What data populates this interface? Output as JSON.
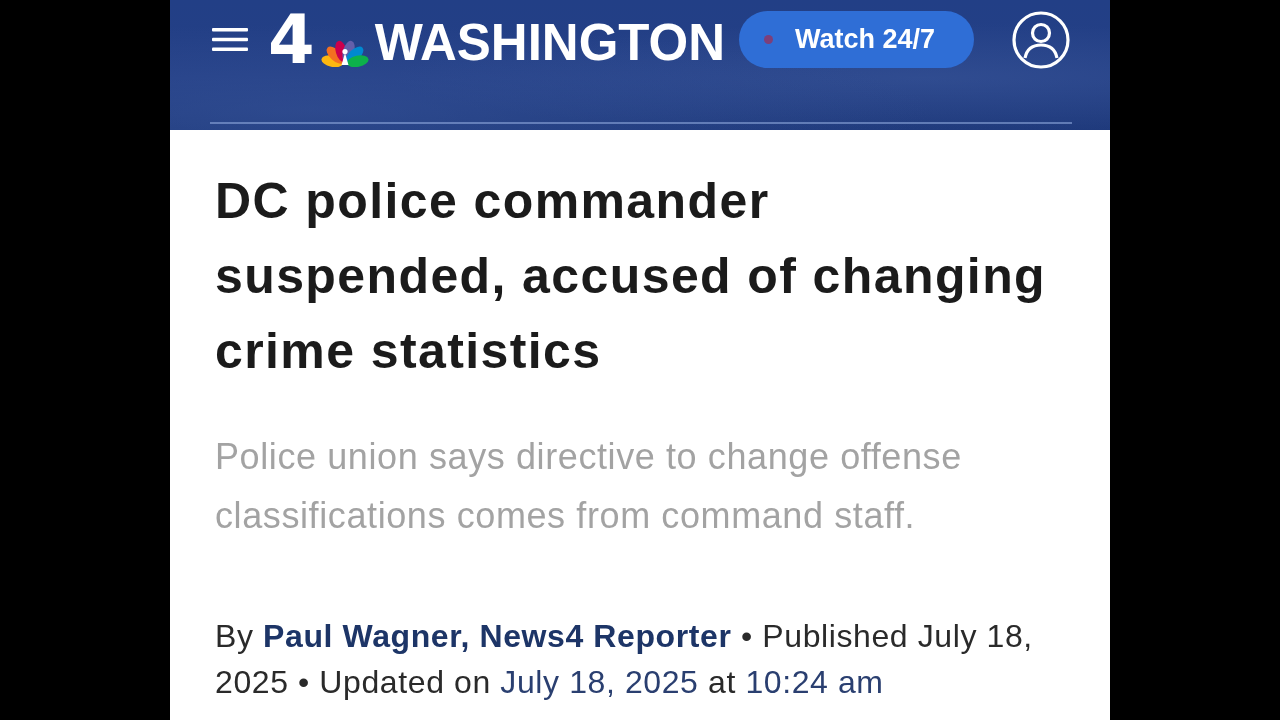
{
  "header": {
    "logo": {
      "number": "4",
      "wordmark": "WASHINGTON"
    },
    "watch_button": {
      "label": "Watch 24/7"
    }
  },
  "article": {
    "headline": "DC police commander suspended, accused of changing crime statistics",
    "subheadline": "Police union says directive to change offense classifications comes from command staff.",
    "byline": [
      {
        "kind": "plain",
        "text": "By"
      },
      {
        "kind": "author",
        "text": "Paul Wagner, News4 Reporter"
      },
      {
        "kind": "plain",
        "text": "• Published July 18, 2025 • Updated on"
      },
      {
        "kind": "date",
        "text": "July 18, 2025"
      },
      {
        "kind": "plain",
        "text": "at"
      },
      {
        "kind": "date",
        "text": "10:24 am"
      }
    ]
  }
}
